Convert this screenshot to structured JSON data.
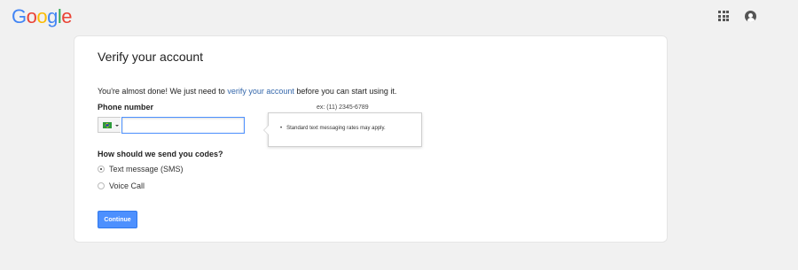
{
  "header": {
    "logo_letters": [
      {
        "char": "G",
        "color": "#4285f4"
      },
      {
        "char": "o",
        "color": "#ea4335"
      },
      {
        "char": "o",
        "color": "#fbbc05"
      },
      {
        "char": "g",
        "color": "#4285f4"
      },
      {
        "char": "l",
        "color": "#34a853"
      },
      {
        "char": "e",
        "color": "#ea4335"
      }
    ],
    "apps_icon": "apps-grid-icon",
    "account_icon": "account-circle-icon"
  },
  "card": {
    "title": "Verify your account",
    "intro_before": "You're almost done! We just need to ",
    "intro_link": "verify your account",
    "intro_after": " before you can start using it.",
    "phone_label": "Phone number",
    "phone_example": "ex: (11) 2345-6789",
    "phone_value": "",
    "country_flag": "brazil-flag-icon",
    "tooltip_text": "Standard text messaging rates may apply.",
    "send_label": "How should we send you codes?",
    "options": [
      {
        "label": "Text message (SMS)",
        "checked": true
      },
      {
        "label": "Voice Call",
        "checked": false
      }
    ],
    "continue_label": "Continue"
  },
  "colors": {
    "accent": "#4d90fe",
    "link": "#3366aa",
    "background": "#f1f1f1"
  }
}
